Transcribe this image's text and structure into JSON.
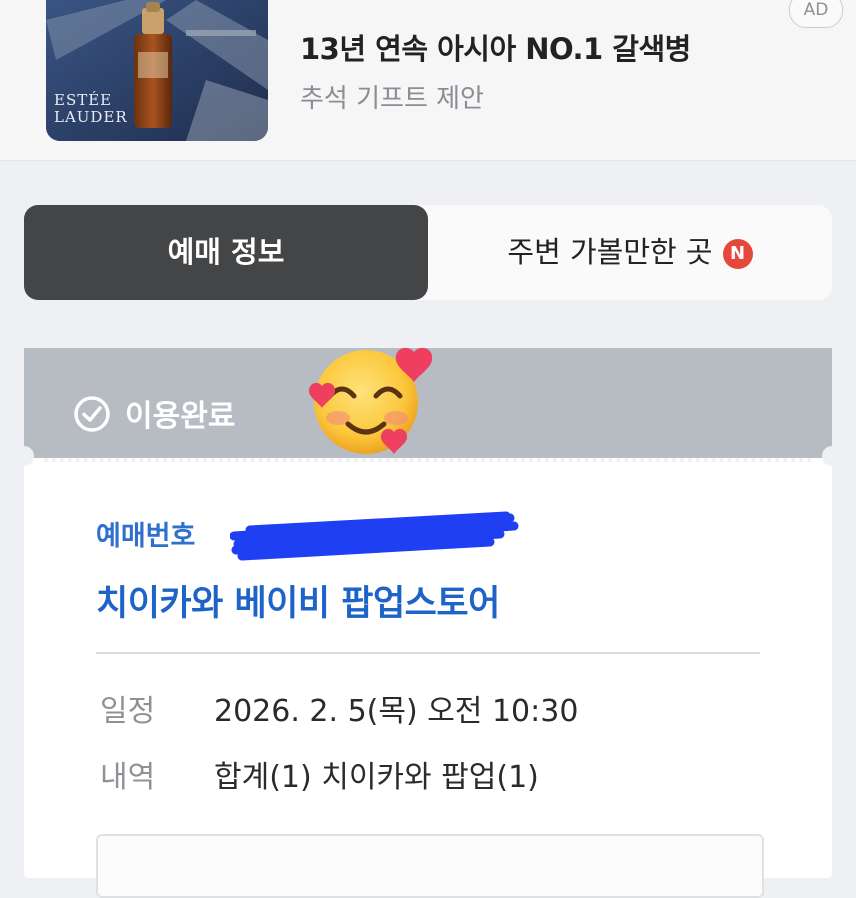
{
  "ad": {
    "brand": "ESTÉE LAUDER",
    "title": "13년 연속 아시아 NO.1 갈색병",
    "subtitle": "추석 기프트 제안",
    "badge": "AD"
  },
  "tabs": {
    "booking_info": "예매 정보",
    "nearby": "주변 가볼만한 곳",
    "nearby_badge": "N"
  },
  "status": {
    "label": "이용완료",
    "emoji": "smiling-face-with-hearts"
  },
  "ticket": {
    "booking_number_label": "예매번호",
    "event_title": "치이카와 베이비 팝업스토어",
    "rows": [
      {
        "label": "일정",
        "value": "2026. 2. 5(목) 오전 10:30"
      },
      {
        "label": "내역",
        "value": "합계(1) 치이카와 팝업(1)"
      }
    ]
  },
  "colors": {
    "accent_blue": "#1e63c7",
    "tab_active_bg": "#444546",
    "status_bar_bg": "#b7bcc3",
    "new_badge": "#e5483a"
  }
}
